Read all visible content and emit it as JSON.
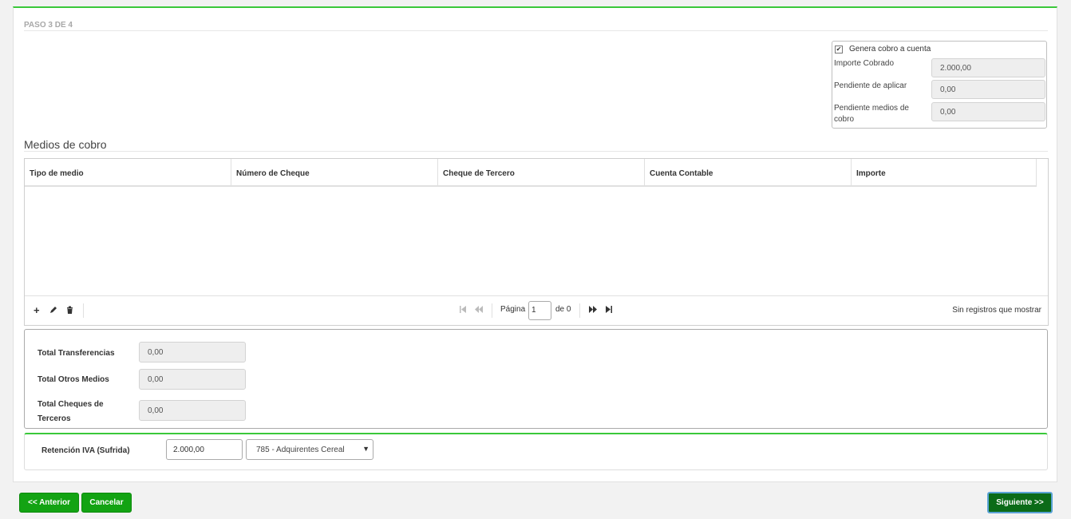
{
  "step": {
    "label": "PASO 3 DE 4"
  },
  "summary": {
    "checkbox_label": "Genera cobro a cuenta",
    "checkbox_checked": true,
    "importe_cobrado_label": "Importe Cobrado",
    "importe_cobrado_value": "2.000,00",
    "pendiente_aplicar_label": "Pendiente de aplicar",
    "pendiente_aplicar_value": "0,00",
    "pendiente_medios_label": "Pendiente medios de cobro",
    "pendiente_medios_value": "0,00"
  },
  "medios": {
    "title": "Medios de cobro",
    "columns": [
      "Tipo de medio",
      "Número de Cheque",
      "Cheque de Tercero",
      "Cuenta Contable",
      "Importe"
    ],
    "rows": []
  },
  "pager": {
    "page_label": "Página",
    "page_value": "1",
    "of_label": "de 0",
    "empty_text": "Sin registros que mostrar"
  },
  "totals": {
    "transferencias_label": "Total Transferencias",
    "transferencias_value": "0,00",
    "otros_label": "Total Otros Medios",
    "otros_value": "0,00",
    "cheques_label": "Total Cheques de Terceros",
    "cheques_value": "0,00"
  },
  "retencion": {
    "label": "Retención IVA (Sufrida)",
    "value": "2.000,00",
    "select_value": "785 - Adquirentes Cereal"
  },
  "buttons": {
    "anterior": "<< Anterior",
    "cancelar": "Cancelar",
    "siguiente": "Siguiente >>"
  },
  "colors": {
    "accent_green": "#3ac83a",
    "button_green": "#13a313",
    "button_dark_green": "#0b6b18"
  }
}
